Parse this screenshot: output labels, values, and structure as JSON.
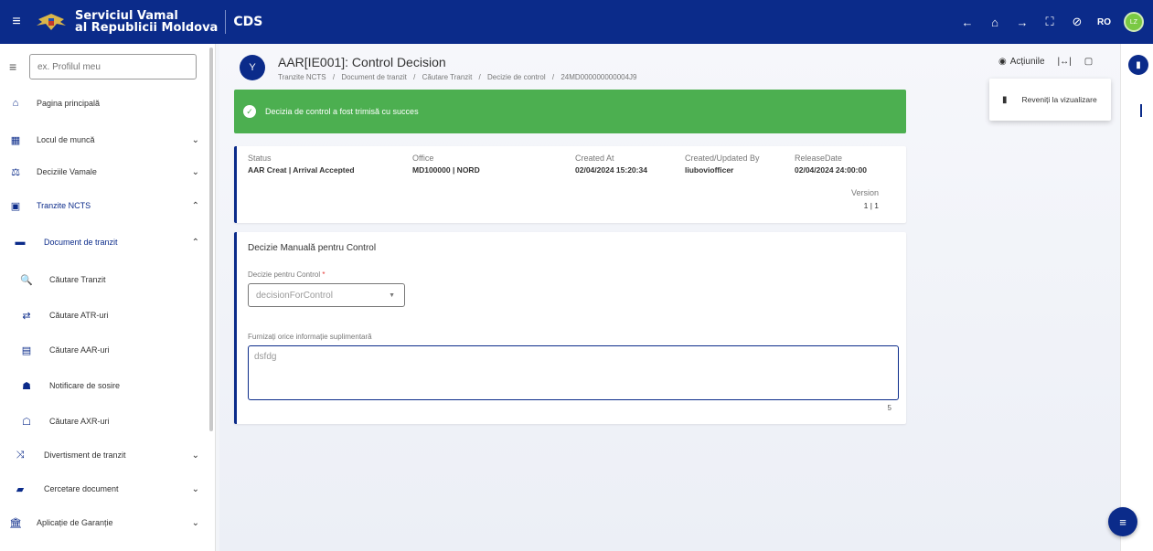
{
  "topbar": {
    "brand_line1": "Serviciul Vamal",
    "brand_line2": "al Republicii Moldova",
    "app_name": "CDS",
    "language": "RO",
    "avatar_initials": "LZ"
  },
  "sidebar": {
    "search_placeholder": "ex. Profilul meu",
    "items": [
      {
        "label": "Pagina principală"
      },
      {
        "label": "Locul de muncă"
      },
      {
        "label": "Deciziile Vamale"
      },
      {
        "label": "Tranzite NCTS"
      },
      {
        "label": "Document de tranzit"
      },
      {
        "label": "Căutare Tranzit"
      },
      {
        "label": "Căutare ATR-uri"
      },
      {
        "label": "Căutare AAR-uri"
      },
      {
        "label": "Notificare de sosire"
      },
      {
        "label": "Căutare AXR-uri"
      },
      {
        "label": "Divertisment de tranzit"
      },
      {
        "label": "Cercetare document"
      },
      {
        "label": "Aplicație de Garanție"
      }
    ]
  },
  "page": {
    "title": "AAR[IE001]: Control Decision",
    "breadcrumb": [
      "Tranzite NCTS",
      "/",
      "Document de tranzit",
      "/",
      "Căutare Tranzit",
      "/",
      "Decizie de control",
      "/",
      "24MD000000000004J9"
    ]
  },
  "alert": {
    "message": "Decizia de control a fost trimisă cu succes",
    "color": "#4caf50"
  },
  "info": {
    "status_label": "Status",
    "status_value": "AAR Creat | Arrival Accepted",
    "office_label": "Office",
    "office_value": "MD100000 | NORD",
    "created_label": "Created At",
    "created_value": "02/04/2024 15:20:34",
    "by_label": "Created/Updated By",
    "by_value": "liuboviofficer",
    "release_label": "ReleaseDate",
    "release_value": "02/04/2024 24:00:00",
    "version_label": "Version",
    "version_value": "1 | 1"
  },
  "form": {
    "title": "Decizie Manuală pentru Control",
    "decision_label": "Decizie pentru Control",
    "decision_required": "*",
    "decision_placeholder": "decisionForControl",
    "info_label": "Furnizați orice informație suplimentară",
    "info_value": "dsfdg",
    "char_count": "5"
  },
  "actions": {
    "label": "Acțiunile",
    "menu_item": "Reveniți la vizualizare"
  },
  "colors": {
    "primary": "#0b2b8a",
    "success": "#4caf50"
  }
}
